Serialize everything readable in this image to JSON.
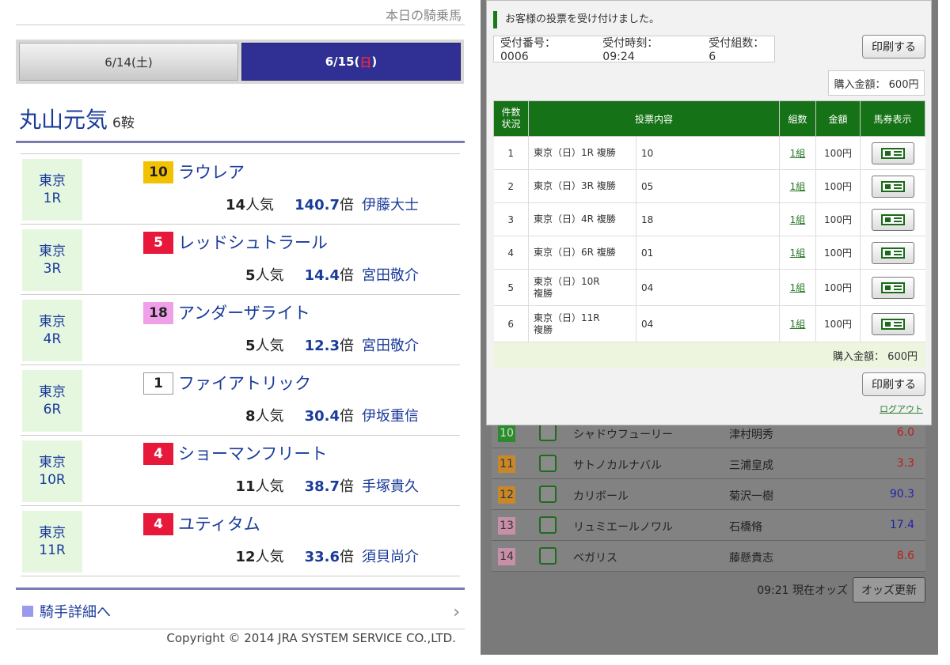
{
  "left": {
    "top_cut_text": "本日の騎乗馬",
    "tabs": [
      {
        "label_pre": "6/14(土)",
        "label_day": "",
        "label_post": "",
        "active": false
      },
      {
        "label_pre": "6/15(",
        "label_day": "日",
        "label_post": ")",
        "active": true
      }
    ],
    "jockey_name": "丸山元気",
    "ride_count": "6鞍",
    "races": [
      {
        "venue": "東京",
        "race": "1R",
        "number": "10",
        "badge_bg": "#f2c200",
        "badge_fg": "#222222",
        "horse": "ラウレア",
        "pop_num": "14",
        "pop_unit": "人気",
        "odds_num": "140.7",
        "odds_unit": "倍",
        "jockey": "伊藤大士"
      },
      {
        "venue": "東京",
        "race": "3R",
        "number": "5",
        "badge_bg": "#e8183a",
        "badge_fg": "#ffffff",
        "horse": "レッドシュトラール",
        "pop_num": "5",
        "pop_unit": "人気",
        "odds_num": "14.4",
        "odds_unit": "倍",
        "jockey": "宮田敬介"
      },
      {
        "venue": "東京",
        "race": "4R",
        "number": "18",
        "badge_bg": "#f0a0e8",
        "badge_fg": "#222222",
        "horse": "アンダーザライト",
        "pop_num": "5",
        "pop_unit": "人気",
        "odds_num": "12.3",
        "odds_unit": "倍",
        "jockey": "宮田敬介"
      },
      {
        "venue": "東京",
        "race": "6R",
        "number": "1",
        "badge_bg": "#ffffff",
        "badge_fg": "#222222",
        "horse": "ファイアトリック",
        "pop_num": "8",
        "pop_unit": "人気",
        "odds_num": "30.4",
        "odds_unit": "倍",
        "jockey": "伊坂重信"
      },
      {
        "venue": "東京",
        "race": "10R",
        "number": "4",
        "badge_bg": "#e8183a",
        "badge_fg": "#ffffff",
        "horse": "ショーマンフリート",
        "pop_num": "11",
        "pop_unit": "人気",
        "odds_num": "38.7",
        "odds_unit": "倍",
        "jockey": "手塚貴久"
      },
      {
        "venue": "東京",
        "race": "11R",
        "number": "4",
        "badge_bg": "#e8183a",
        "badge_fg": "#ffffff",
        "horse": "ユティタム",
        "pop_num": "12",
        "pop_unit": "人気",
        "odds_num": "33.6",
        "odds_unit": "倍",
        "jockey": "須貝尚介"
      }
    ],
    "detail_link": "騎手詳細へ",
    "copyright": "Copyright © 2014 JRA SYSTEM SERVICE CO.,LTD."
  },
  "right": {
    "modal": {
      "title": "お客様の投票を受け付けました。",
      "receipt_no": "受付番号： 0006",
      "receipt_time": "受付時刻： 09:24",
      "receipt_count": "受付組数： 6",
      "print_label": "印刷する",
      "total_label": "購入金額： 600円",
      "headers": {
        "status": "件数\n状況",
        "content": "投票内容",
        "kumi": "組数",
        "amount": "金額",
        "ticket": "馬券表示"
      },
      "bets": [
        {
          "idx": "1",
          "race": "東京（日）1R 複勝",
          "horse": "10",
          "kumi": "1組",
          "amount": "100円"
        },
        {
          "idx": "2",
          "race": "東京（日）3R 複勝",
          "horse": "05",
          "kumi": "1組",
          "amount": "100円"
        },
        {
          "idx": "3",
          "race": "東京（日）4R 複勝",
          "horse": "18",
          "kumi": "1組",
          "amount": "100円"
        },
        {
          "idx": "4",
          "race": "東京（日）6R 複勝",
          "horse": "01",
          "kumi": "1組",
          "amount": "100円"
        },
        {
          "idx": "5",
          "race": "東京（日）10R\n複勝",
          "horse": "04",
          "kumi": "1組",
          "amount": "100円"
        },
        {
          "idx": "6",
          "race": "東京（日）11R\n複勝",
          "horse": "04",
          "kumi": "1組",
          "amount": "100円"
        }
      ],
      "logout": "ログアウト"
    },
    "background_rows": [
      {
        "num": "10",
        "num_bg": "#2e8a2e",
        "num_fg": "#cfe8cf",
        "horse": "シャドウフューリー",
        "jockey": "津村明秀",
        "odds": "6.0",
        "odds_color": "#b82020"
      },
      {
        "num": "11",
        "num_bg": "#c8882a",
        "num_fg": "#333333",
        "horse": "サトノカルナバル",
        "jockey": "三浦皇成",
        "odds": "3.3",
        "odds_color": "#b82020"
      },
      {
        "num": "12",
        "num_bg": "#c8882a",
        "num_fg": "#333333",
        "horse": "カリボール",
        "jockey": "菊沢一樹",
        "odds": "90.3",
        "odds_color": "#2222aa"
      },
      {
        "num": "13",
        "num_bg": "#c890a8",
        "num_fg": "#333333",
        "horse": "リュミエールノワル",
        "jockey": "石橋脩",
        "odds": "17.4",
        "odds_color": "#2222aa"
      },
      {
        "num": "14",
        "num_bg": "#c890a8",
        "num_fg": "#333333",
        "horse": "ベガリス",
        "jockey": "藤懸貴志",
        "odds": "8.6",
        "odds_color": "#b82020"
      }
    ],
    "odds_time": "09:21 現在オッズ",
    "odds_update": "オッズ更新"
  }
}
